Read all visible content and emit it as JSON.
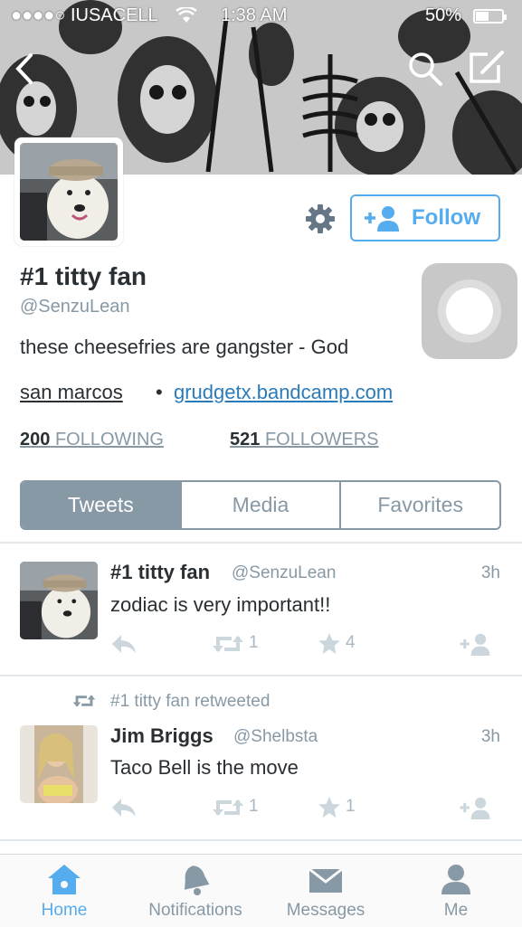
{
  "status_bar": {
    "carrier": "●●●●○ IUSACELL",
    "time": "1:38 AM",
    "battery": "50%",
    "battery_level": 0.5
  },
  "header": {
    "back_icon": "chevron-left-icon",
    "search_icon": "search-icon",
    "compose_icon": "compose-icon"
  },
  "profile": {
    "name": "#1 titty fan",
    "handle": "@SenzuLean",
    "bio": "these cheesefries are gangster - God",
    "location": "san marcos",
    "separator": "•",
    "website": "grudgetx.bandcamp.com",
    "following_count": "200",
    "following_label": "FOLLOWING",
    "followers_count": "521",
    "followers_label": "FOLLOWERS",
    "follow_label": "Follow"
  },
  "tabs": [
    {
      "label": "Tweets",
      "active": true
    },
    {
      "label": "Media",
      "active": false
    },
    {
      "label": "Favorites",
      "active": false
    }
  ],
  "tweets": [
    {
      "name": "#1 titty fan",
      "handle": "@SenzuLean",
      "time": "3h",
      "text": "zodiac is very important!!",
      "retweets": "1",
      "favorites": "4"
    },
    {
      "retweeted_by": "#1 titty fan retweeted",
      "name": "Jim Briggs",
      "handle": "@Shelbsta",
      "time": "3h",
      "text": "Taco Bell is the move",
      "retweets": "1",
      "favorites": "1"
    }
  ],
  "nav": [
    {
      "label": "Home",
      "icon": "home-icon",
      "active": true
    },
    {
      "label": "Notifications",
      "icon": "bell-icon",
      "active": false
    },
    {
      "label": "Messages",
      "icon": "envelope-icon",
      "active": false
    },
    {
      "label": "Me",
      "icon": "person-icon",
      "active": false
    }
  ],
  "colors": {
    "accent": "#55acee",
    "muted": "#8899a6",
    "text": "#292f33",
    "link": "#2b7bb9"
  }
}
